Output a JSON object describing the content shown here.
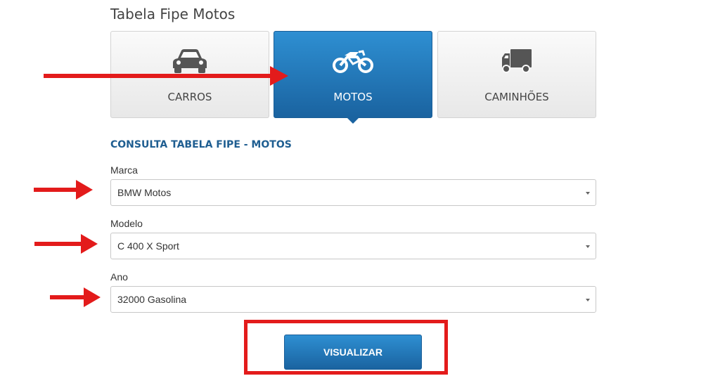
{
  "page": {
    "title": "Tabela Fipe Motos"
  },
  "tabs": [
    {
      "label": "CARROS",
      "icon": "car-icon",
      "active": false
    },
    {
      "label": "MOTOS",
      "icon": "motorcycle-icon",
      "active": true
    },
    {
      "label": "CAMINHÕES",
      "icon": "truck-icon",
      "active": false
    }
  ],
  "form": {
    "title": "CONSULTA TABELA FIPE - MOTOS",
    "marca": {
      "label": "Marca",
      "value": "BMW Motos"
    },
    "modelo": {
      "label": "Modelo",
      "value": "C 400 X Sport"
    },
    "ano": {
      "label": "Ano",
      "value": "32000 Gasolina"
    },
    "submit_label": "VISUALIZAR"
  },
  "colors": {
    "accent": "#1a63a0",
    "accent_light": "#2e8fd2",
    "section_title": "#1f5e91",
    "annotation_red": "#e31b1b"
  }
}
